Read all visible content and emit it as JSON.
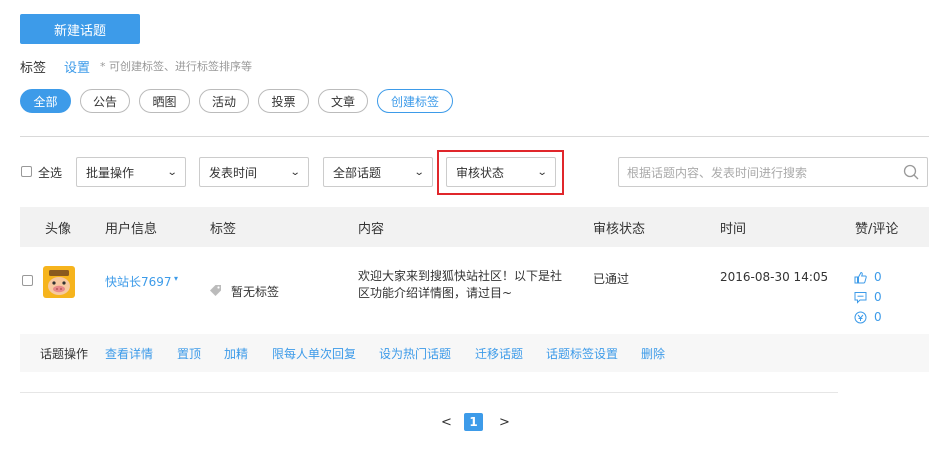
{
  "toolbar": {
    "new_topic": "新建话题"
  },
  "tags": {
    "label": "标签",
    "settings_link": "设置",
    "hint": "* 可创建标签、进行标签排序等",
    "items": [
      "全部",
      "公告",
      "晒图",
      "活动",
      "投票",
      "文章"
    ],
    "create_label": "创建标签"
  },
  "filters": {
    "select_all": "全选",
    "bulk": "批量操作",
    "time": "发表时间",
    "topics": "全部话题",
    "review": "审核状态",
    "search_placeholder": "根据话题内容、发表时间进行搜索"
  },
  "table": {
    "headers": [
      "头像",
      "用户信息",
      "标签",
      "内容",
      "审核状态",
      "时间",
      "赞/评论"
    ],
    "row": {
      "user": "快站长7697",
      "tag": "暂无标签",
      "content_line1": "欢迎大家来到搜狐快站社区！以下是社",
      "content_line2": "区功能介绍详情图，请过目~",
      "status": "已通过",
      "time": "2016-08-30 14:05",
      "likes": "0",
      "comments": "0",
      "rewards": "0"
    }
  },
  "ops": {
    "label": "话题操作",
    "actions": [
      "查看详情",
      "置顶",
      "加精",
      "限每人单次回复",
      "设为热门话题",
      "迁移话题",
      "话题标签设置",
      "删除"
    ]
  },
  "pagination": {
    "prev": "<",
    "current": "1",
    "next": ">"
  },
  "colors": {
    "accent": "#3d9be9",
    "highlight": "#e0262b"
  }
}
